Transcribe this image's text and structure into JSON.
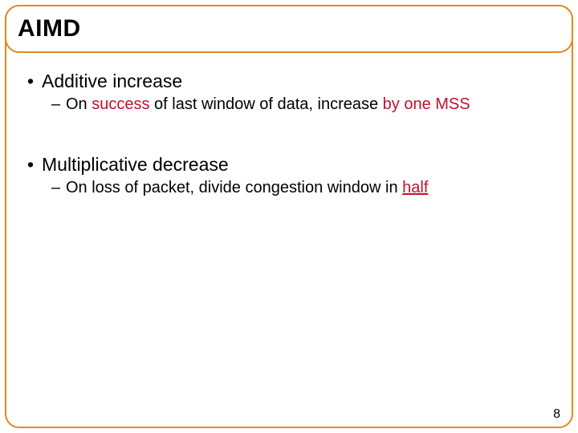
{
  "title": "AIMD",
  "bullets": {
    "b1": "Additive increase",
    "b1_sub_pre": "On ",
    "b1_sub_hl": "success",
    "b1_sub_mid": " of last window of data, increase ",
    "b1_sub_hl2": "by one MSS",
    "b2": "Multiplicative decrease",
    "b2_sub_pre": "On loss of packet, divide congestion window in ",
    "b2_sub_hl": "half"
  },
  "page": "8",
  "glyphs": {
    "dot": "•",
    "dash": "–"
  }
}
